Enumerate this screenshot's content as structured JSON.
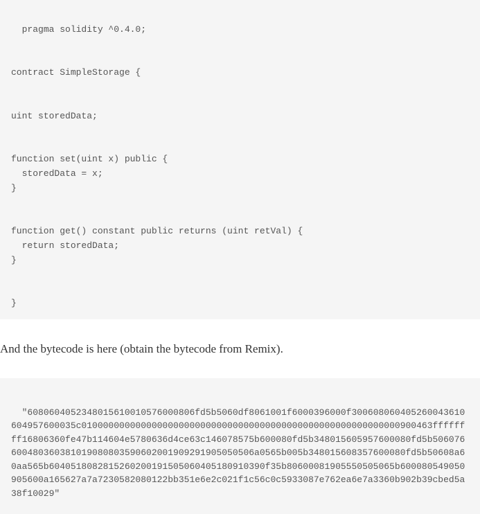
{
  "solidity_code": "pragma solidity ^0.4.0;\n\n\ncontract SimpleStorage {\n\n\nuint storedData;\n\n\nfunction set(uint x) public {\n  storedData = x;\n}\n\n\nfunction get() constant public returns (uint retVal) {\n  return storedData;\n}\n\n\n}",
  "prose_text": "And the bytecode is here (obtain the bytecode from Remix).",
  "bytecode": "\"6080604052348015610010576000806fd5b5060df8061001f6000396000f300608060405260043610604957600035c01000000000000000000000000000000000000000000000000000000000900463ffffffff16806360fe47b114604e5780636d4ce63c146078575b600080fd5b348015605957600080fd5b506076600480360381019080803590602001909291905050506a0565b005b348015608357600080fd5b50608a60aa565b6040518082815260200191505060405180910390f35b80600081905550505065b600080549050905600a165627a7a7230582080122bb351e6e2c021f1c56c0c5933087e762ea6e7a3360b902b39cbed5a38f10029\""
}
